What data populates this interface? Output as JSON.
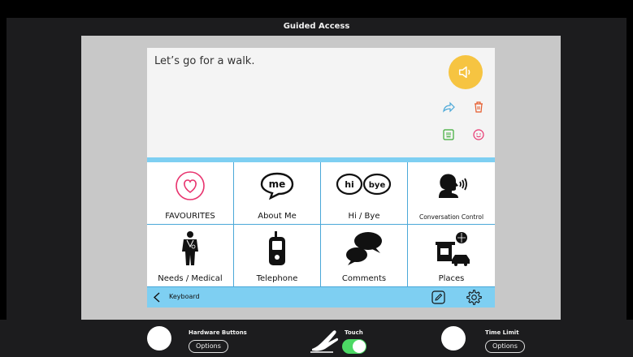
{
  "guided_access": {
    "title": "Guided Access"
  },
  "message": {
    "text": "Let’s go for a walk."
  },
  "grid": {
    "items": [
      {
        "label": "FAVOURITES",
        "icon": "heart-icon"
      },
      {
        "label": "About Me",
        "icon": "me-bubble-icon"
      },
      {
        "label": "Hi / Bye",
        "icon": "hi-bye-bubbles-icon"
      },
      {
        "label": "Conversation Control",
        "icon": "speaking-head-icon"
      },
      {
        "label": "Needs / Medical",
        "icon": "person-medical-icon"
      },
      {
        "label": "Telephone",
        "icon": "mobile-phone-icon"
      },
      {
        "label": "Comments",
        "icon": "speech-bubbles-icon"
      },
      {
        "label": "Places",
        "icon": "places-icon"
      }
    ]
  },
  "bottom_bar": {
    "keyboard_label": "Keyboard"
  },
  "controls": {
    "hardware_buttons": {
      "title": "Hardware Buttons",
      "options": "Options"
    },
    "touch": {
      "title": "Touch",
      "enabled": true
    },
    "time_limit": {
      "title": "Time Limit",
      "options": "Options"
    }
  },
  "colors": {
    "accent_blue": "#7ecff2",
    "speaker_yellow": "#f6c441",
    "toggle_green": "#4cd964",
    "heart_pink": "#e8336e"
  }
}
